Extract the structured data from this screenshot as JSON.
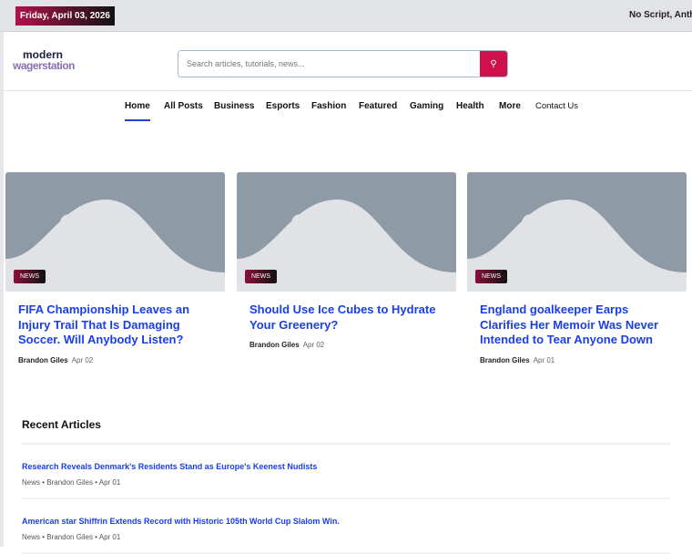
{
  "topbar": {
    "date": "Friday, April 03, 2026",
    "right_text": "No Script, Anthor"
  },
  "logo": {
    "line1": "modern",
    "line2": "wagerstation"
  },
  "search": {
    "placeholder": "Search articles, tutorials, news...",
    "icon": "search-icon"
  },
  "nav": [
    "Home",
    "All Posts",
    "Business",
    "Esports",
    "Fashion",
    "Featured",
    "Gaming",
    "Health",
    "More",
    "Contact Us"
  ],
  "cards": [
    {
      "badge": "NEWS",
      "title": "FIFA Championship Leaves an Injury Trail That Is Damaging Soccer. Will Anybody Listen?",
      "author": "Brandon Giles",
      "date": "Apr 02"
    },
    {
      "badge": "NEWS",
      "title": "Should Use Ice Cubes to Hydrate Your Greenery?",
      "author": "Brandon Giles",
      "date": "Apr 02"
    },
    {
      "badge": "NEWS",
      "title": "England goalkeeper Earps Clarifies Her Memoir Was Never Intended to Tear Anyone Down",
      "author": "Brandon Giles",
      "date": "Apr 01"
    }
  ],
  "recent": {
    "heading": "Recent Articles",
    "items": [
      {
        "title": "Research Reveals Denmark's Residents Stand as Europe's Keenest Nudists",
        "meta": "News • Brandon Giles • Apr 01"
      },
      {
        "title": "American star Shiffrin Extends Record with Historic 105th World Cup Slalom Win.",
        "meta": "News • Brandon Giles • Apr 01"
      }
    ]
  },
  "colors": {
    "accent": "#d0104c",
    "link": "#1a3ee8"
  }
}
